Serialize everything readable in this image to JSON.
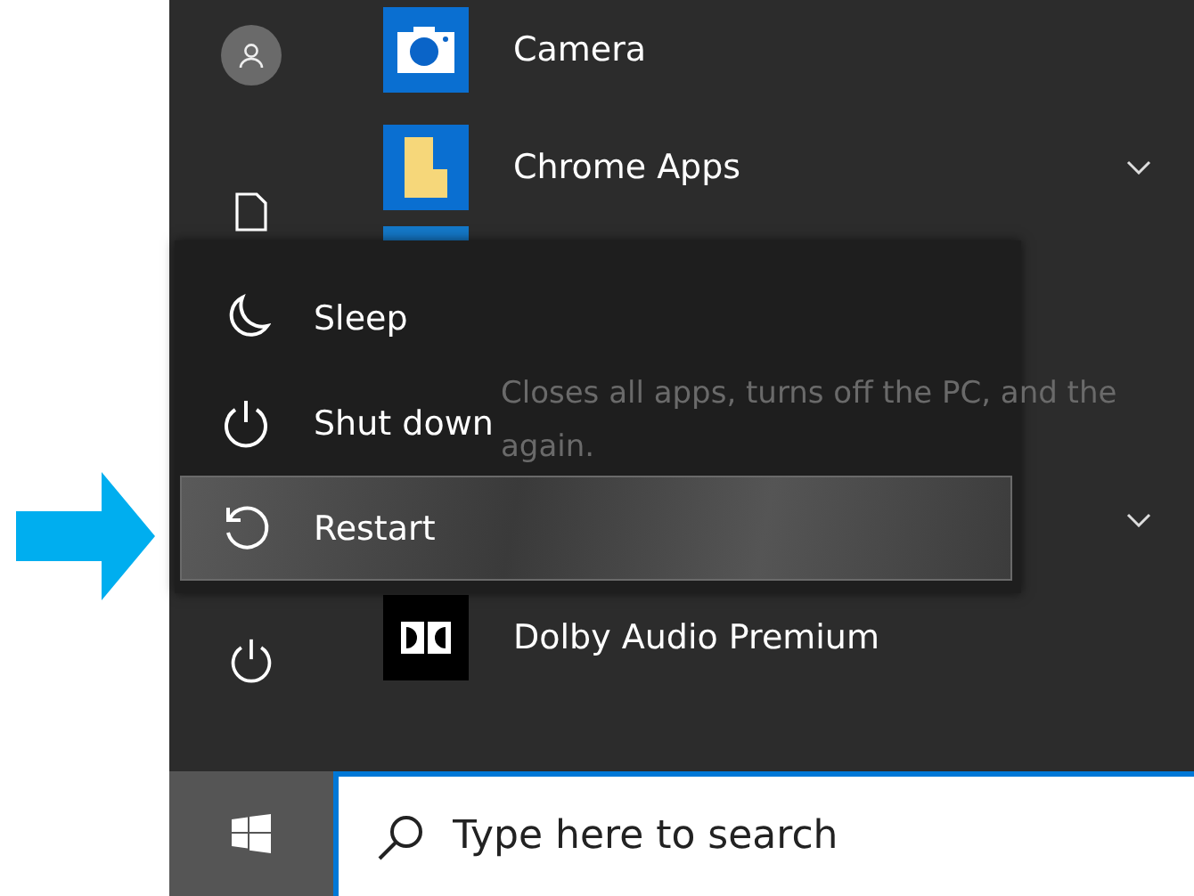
{
  "apps": [
    {
      "kind": "app",
      "name": "Camera"
    },
    {
      "kind": "folder",
      "name": "Chrome Apps"
    },
    {
      "kind": "tile-only"
    },
    {
      "kind": "gap"
    },
    {
      "kind": "folder-covered"
    },
    {
      "kind": "app",
      "name": "Dolby Audio Premium"
    }
  ],
  "power_menu": {
    "items": [
      {
        "label": "Sleep",
        "selected": false
      },
      {
        "label": "Shut down",
        "selected": false
      },
      {
        "label": "Restart",
        "selected": true
      }
    ]
  },
  "tooltip": {
    "lines": [
      "Closes all apps, turns off the PC, and the",
      "again."
    ]
  },
  "search": {
    "placeholder": "Type here to search"
  }
}
